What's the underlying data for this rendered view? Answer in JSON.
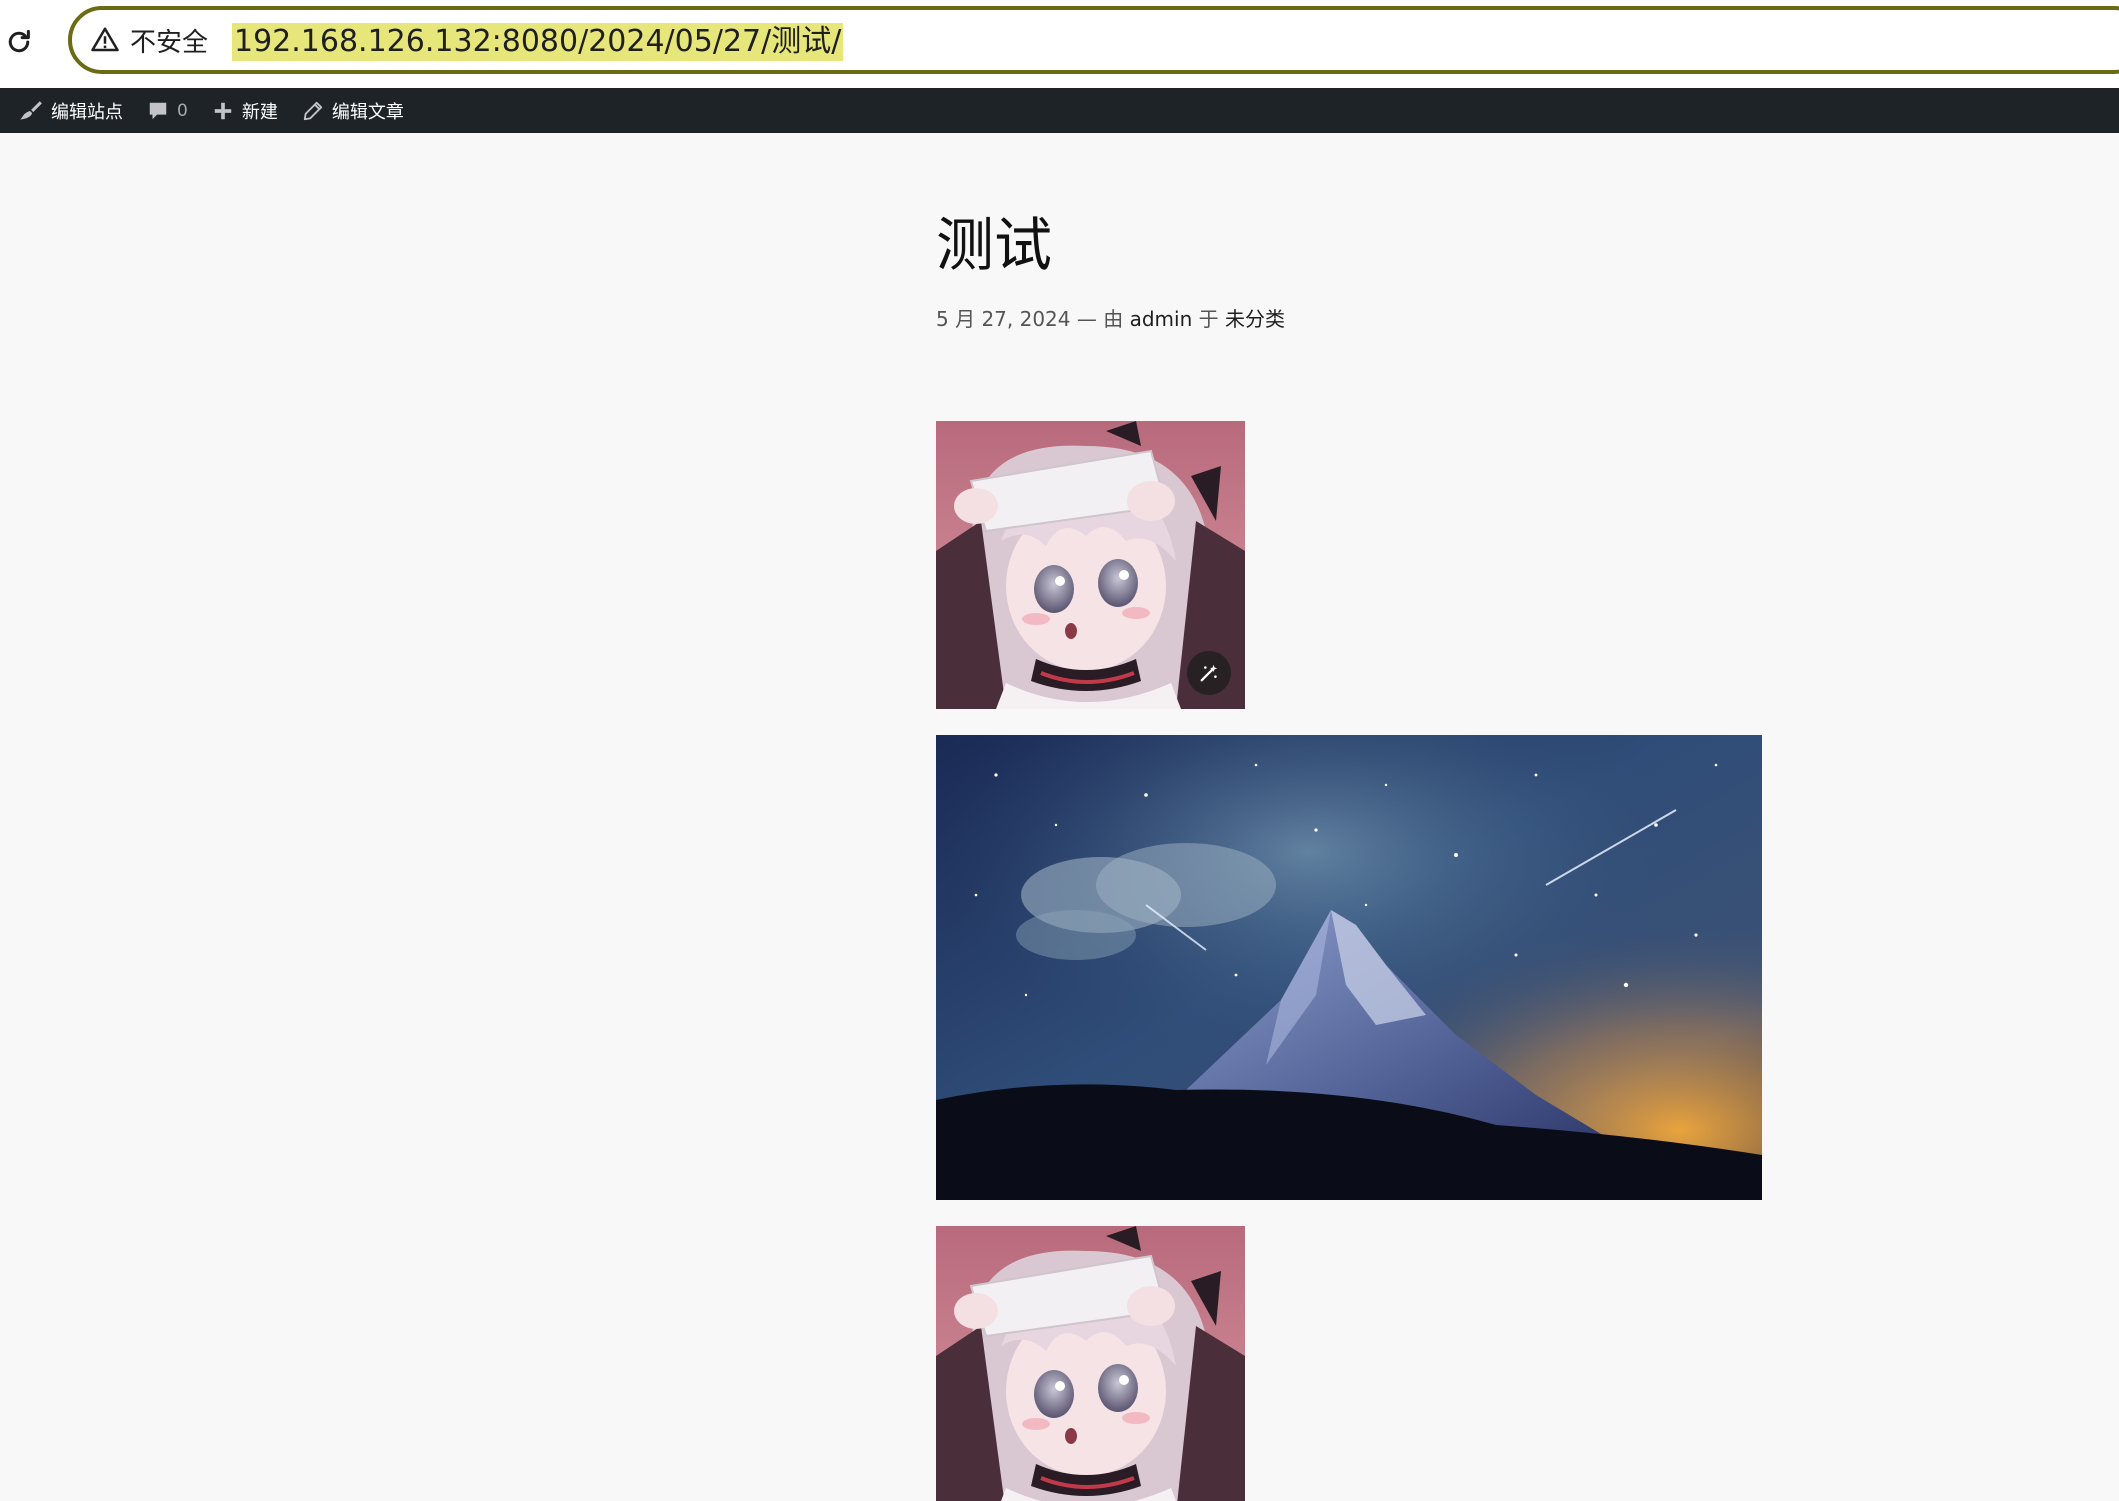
{
  "browser": {
    "security_label": "不安全",
    "url": "192.168.126.132:8080/2024/05/27/测试/"
  },
  "admin_bar": {
    "items": [
      {
        "label": "编辑站点",
        "icon": "brush-icon"
      },
      {
        "label": "0",
        "icon": "comment-icon"
      },
      {
        "label": "新建",
        "icon": "plus-icon"
      },
      {
        "label": "编辑文章",
        "icon": "pencil-icon"
      }
    ]
  },
  "post": {
    "title": "测试",
    "date": "5 月 27, 2024",
    "separator": "— 由",
    "author": "admin",
    "in_label": "于",
    "category": "未分类"
  },
  "images": [
    {
      "subject": "anime-girl-holding-paper"
    },
    {
      "subject": "starry-night-mountain"
    },
    {
      "subject": "anime-girl-holding-paper"
    }
  ],
  "colors": {
    "admin_bar_bg": "#1d2327",
    "url_highlight": "#e6e67a",
    "omnibox_border": "#6b6b13",
    "page_bg": "#f8f8f8"
  }
}
